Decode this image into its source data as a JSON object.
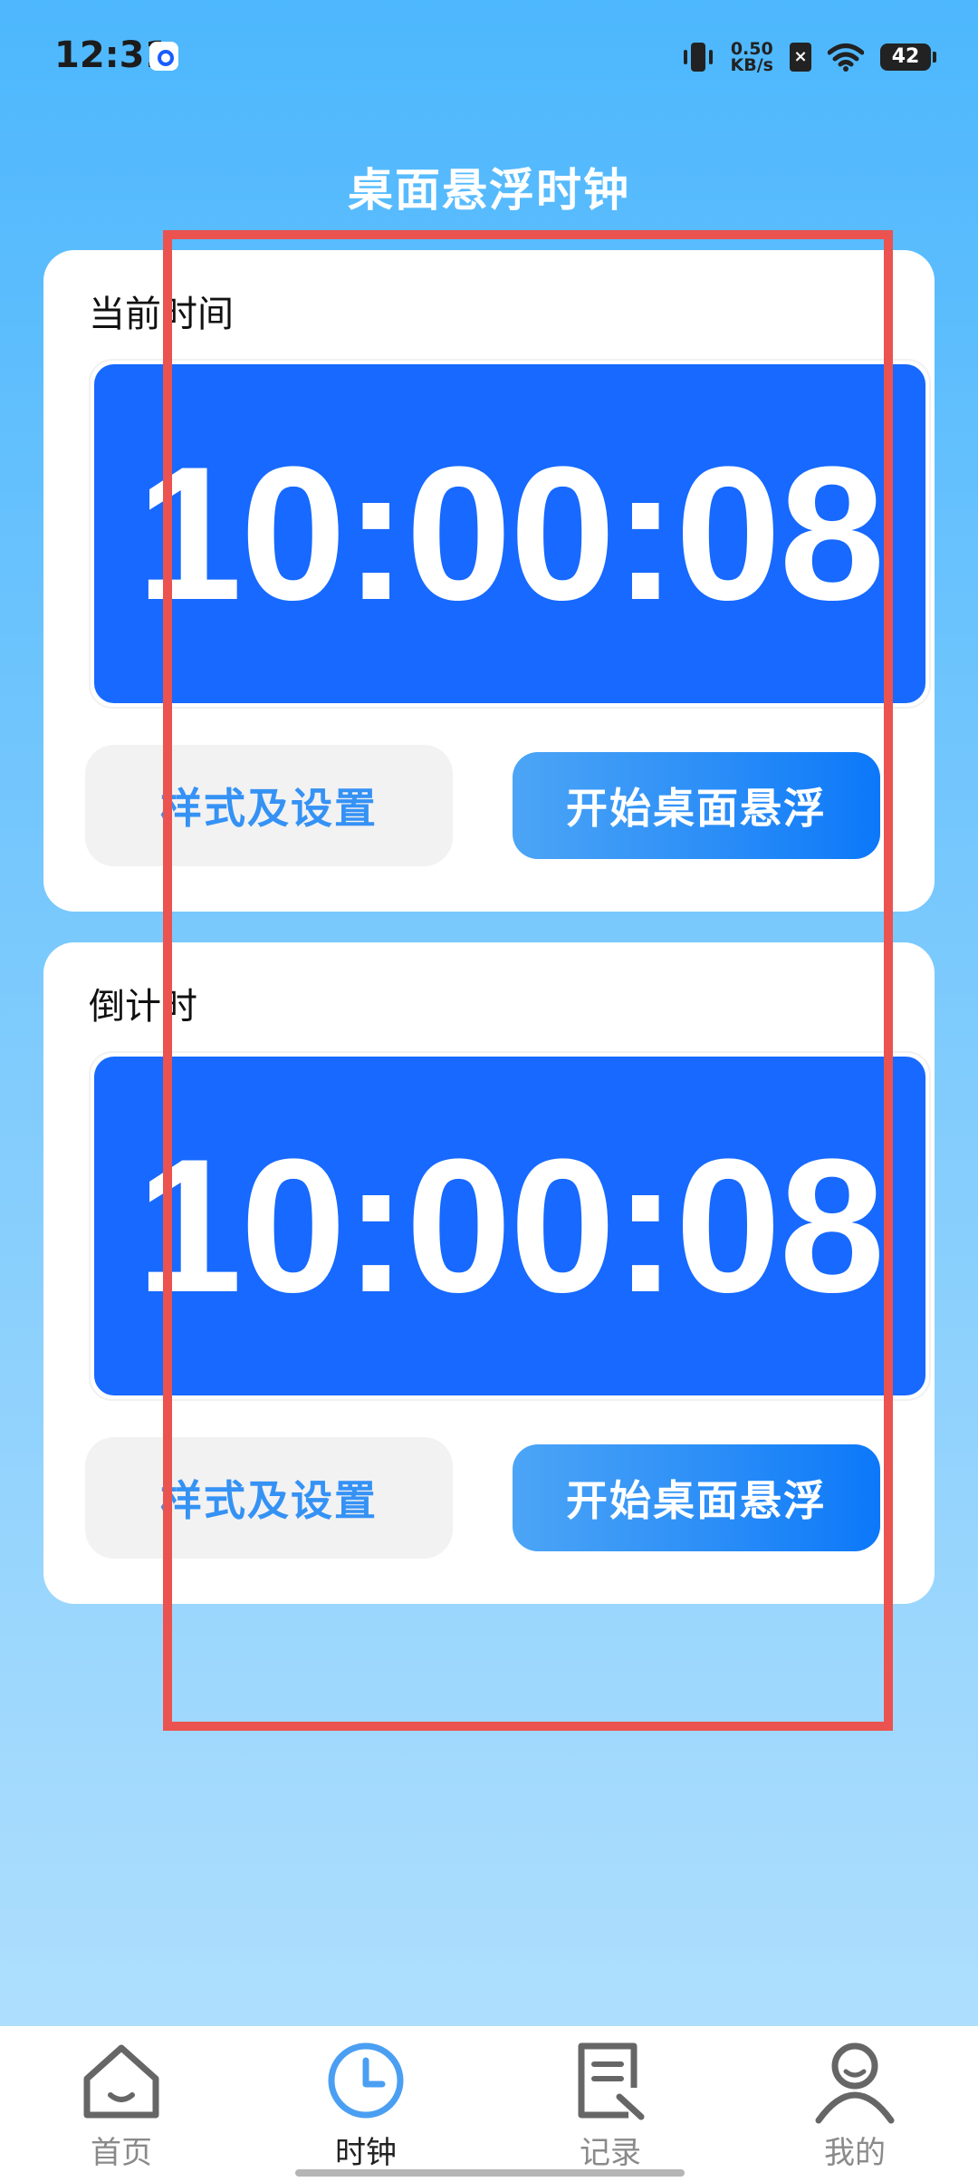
{
  "status_bar": {
    "time": "12:31",
    "net_speed_value": "0.50",
    "net_speed_unit": "KB/s",
    "sim_label": "×",
    "battery": "42"
  },
  "page": {
    "title": "桌面悬浮时钟"
  },
  "cards": {
    "current": {
      "label": "当前时间",
      "time": "10:00:08",
      "settings_button": "样式及设置",
      "float_button": "开始桌面悬浮"
    },
    "countdown": {
      "label": "倒计时",
      "time": "10:00:08",
      "settings_button": "样式及设置",
      "float_button": "开始桌面悬浮"
    }
  },
  "tabs": [
    {
      "label": "首页",
      "icon": "home-icon",
      "active": false
    },
    {
      "label": "时钟",
      "icon": "clock-icon",
      "active": true
    },
    {
      "label": "记录",
      "icon": "record-icon",
      "active": false
    },
    {
      "label": "我的",
      "icon": "profile-icon",
      "active": false
    }
  ],
  "colors": {
    "accent": "#1769ff",
    "tab_active": "#4a9ff2",
    "highlight": "#eb5350"
  }
}
